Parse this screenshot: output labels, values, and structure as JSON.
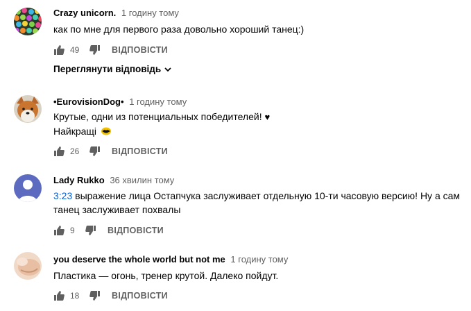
{
  "comments": [
    {
      "author": "Crazy unicorn.",
      "time": "1 годину тому",
      "text": "как по мне для первого раза довольно хороший танец:)",
      "likes": "49",
      "reply_label": "ВІДПОВІСТИ",
      "view_replies_label": "Переглянути відповідь"
    },
    {
      "author": "•EurovisionDog•",
      "time": "1 годину тому",
      "text_line1": "Крутые, одни из потенциальных победителей!",
      "heart": "♥",
      "text_line2": "Найкращі",
      "likes": "26",
      "reply_label": "ВІДПОВІСТИ"
    },
    {
      "author": "Lady Rukko",
      "time": "36 хвилин тому",
      "timestamp": "3:23",
      "text_line1": "выражение лица Остапчука заслуживает отдельную 10-ти часовую версию! Ну а сам",
      "text_line2": "танец заслуживает похвалы",
      "likes": "9",
      "reply_label": "ВІДПОВІСТИ"
    },
    {
      "author": "you deserve the whole world but not me",
      "time": "1 годину тому",
      "text": "Пластика — огонь, тренер крутой. Далеко пойдут.",
      "likes": "18",
      "reply_label": "ВІДПОВІСТИ"
    }
  ],
  "colors": {
    "link": "#065fd4",
    "secondary": "#606060",
    "primary": "#030303",
    "avatar_default": "#5c6bc0"
  }
}
